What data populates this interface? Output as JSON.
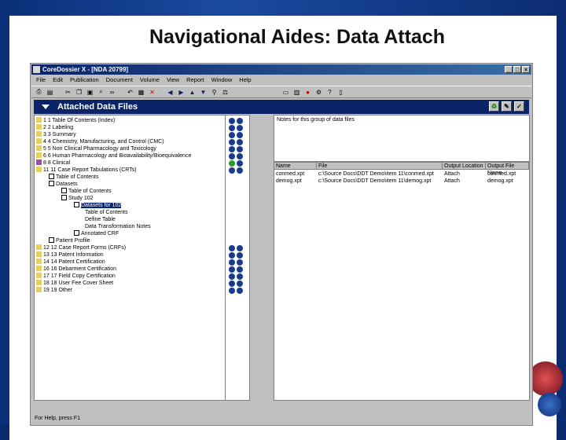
{
  "slide": {
    "title": "Navigational Aides: Data Attach",
    "colors": {
      "background": "#0b2f78",
      "panel": "#ffffff",
      "accent": "#0a246a"
    }
  },
  "window": {
    "title": "CoreDossier X - [NDA 20799]",
    "menu": [
      "File",
      "Edit",
      "Publication",
      "Document",
      "Volume",
      "View",
      "Report",
      "Window",
      "Help"
    ],
    "toolbar_icons": [
      "print-icon",
      "preview-icon",
      "cut-icon",
      "copy-icon",
      "paste-icon",
      "find-icon",
      "binoculars-icon",
      "undo-icon",
      "delete-icon",
      "close-icon",
      "back-arrow-icon",
      "forward-arrow-icon",
      "up-arrow-icon",
      "down-arrow-icon",
      "attach-icon",
      "scale-icon",
      "document-icon",
      "chart-icon",
      "print-doc-icon",
      "gear-icon",
      "help-icon",
      "book-icon"
    ],
    "buttons": {
      "minimize": "_",
      "restore": "□",
      "close": "×"
    }
  },
  "panel": {
    "title": "Attached Data Files",
    "buttons": [
      "refresh-icon",
      "edit-icon",
      "check-icon"
    ]
  },
  "tree": {
    "items": [
      {
        "label": "1 1 Table Of Contents (Index)",
        "level": 0
      },
      {
        "label": "2 2 Labeling",
        "level": 0
      },
      {
        "label": "3 3 Summary",
        "level": 0
      },
      {
        "label": "4 4 Chemistry, Manufacturing, and Control (CMC)",
        "level": 0
      },
      {
        "label": "5 5 Non Clinical Pharmacology and Toxicology",
        "level": 0
      },
      {
        "label": "6 6 Human Pharmacology and Bioavailability/Bioequivalence",
        "level": 0
      },
      {
        "label": "8 8 Clinical",
        "level": 0
      },
      {
        "label": "11 11 Case Report Tabulations (CRTs)",
        "level": 0
      },
      {
        "label": "Table of Contents",
        "level": 1
      },
      {
        "label": "Datasets",
        "level": 1
      },
      {
        "label": "Table of Contents",
        "level": 2
      },
      {
        "label": "Study 102",
        "level": 2
      },
      {
        "label": "Datasets for 102",
        "level": 3
      },
      {
        "label": "Table of Contents",
        "level": 4
      },
      {
        "label": "Define Table",
        "level": 4
      },
      {
        "label": "Data Transformation Notes",
        "level": 4
      },
      {
        "label": "Annotated CRF",
        "level": 3
      },
      {
        "label": "Patient Profile",
        "level": 1
      },
      {
        "label": "12 12 Case Report Forms (CRFs)",
        "level": 0
      },
      {
        "label": "13 13 Patent Information",
        "level": 0
      },
      {
        "label": "14 14 Patent Certification",
        "level": 0
      },
      {
        "label": "16 16 Debarment Certification",
        "level": 0
      },
      {
        "label": "17 17 Field Copy Certification",
        "level": 0
      },
      {
        "label": "18 18 User Fee Cover Sheet",
        "level": 0
      },
      {
        "label": "19 19 Other",
        "level": 0
      }
    ],
    "selected_index": 12
  },
  "notes": {
    "label": "Notes for this group of data files"
  },
  "attachments": {
    "columns": [
      "Name",
      "File",
      "Output Location",
      "Output File Name"
    ],
    "rows": [
      {
        "name": "conmed.xpt",
        "file": "c:\\Source Docs\\DDT Demo\\item 11\\conmed.xpt",
        "location": "Attach",
        "output": "conmed.xpt"
      },
      {
        "name": "demog.xpt",
        "file": "c:\\Source Docs\\DDT Demo\\item 11\\demog.xpt",
        "location": "Attach",
        "output": "demog.xpt"
      }
    ]
  },
  "status": {
    "text": "For Help, press F1"
  }
}
